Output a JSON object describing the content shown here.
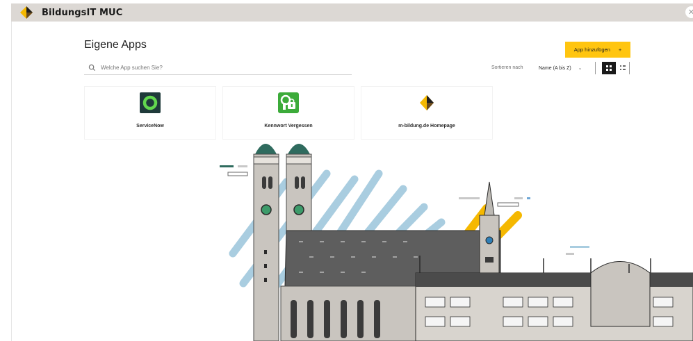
{
  "header": {
    "brand_name": "BildungsIT MUC"
  },
  "main": {
    "title": "Eigene Apps",
    "search_placeholder": "Welche App suchen Sie?",
    "add_button_label": "App hinzufügen",
    "add_button_symbol": "+",
    "sort_label": "Sortieren nach",
    "sort_value": "Name (A bis Z)",
    "sort_chevron": "⌄"
  },
  "apps": [
    {
      "label": "ServiceNow",
      "icon": "servicenow-icon"
    },
    {
      "label": "Kennwort Vergessen",
      "icon": "password-reset-icon"
    },
    {
      "label": "m-bildung.de Homepage",
      "icon": "m-bildung-logo-icon"
    }
  ],
  "colors": {
    "accent": "#ffc510",
    "topbar": "#dcd8d4",
    "servicenow_green": "#62d84e",
    "password_green": "#3cab3a"
  }
}
